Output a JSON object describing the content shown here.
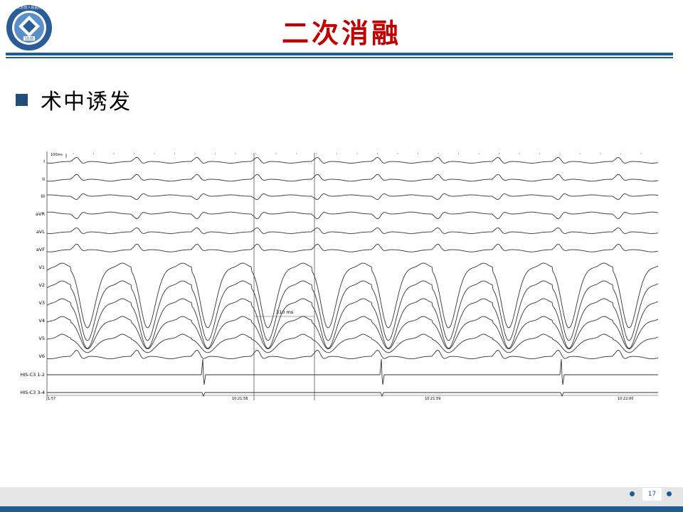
{
  "slide": {
    "title": "二次消融",
    "bullet": "术中诱发",
    "page_number": "17",
    "colors": {
      "title": "#c00000",
      "accent": "#1f5d8f",
      "bullet": "#1f4e79"
    }
  },
  "logo": {
    "ring_text": "江苏省人民医院",
    "year": "1936",
    "icon": "hospital-seal"
  },
  "ecg": {
    "scale_label": "100ms",
    "leads": [
      "I",
      "II",
      "III",
      "aVR",
      "aVL",
      "aVF",
      "V1",
      "V2",
      "V3",
      "V4",
      "V5",
      "V6",
      "HIS-C3 1-2",
      "HIS-C3 3-4"
    ],
    "interval_label": "310 ms",
    "timestamps": [
      "1:57",
      "10:21:58",
      "10:21:59",
      "10:22:00"
    ]
  }
}
